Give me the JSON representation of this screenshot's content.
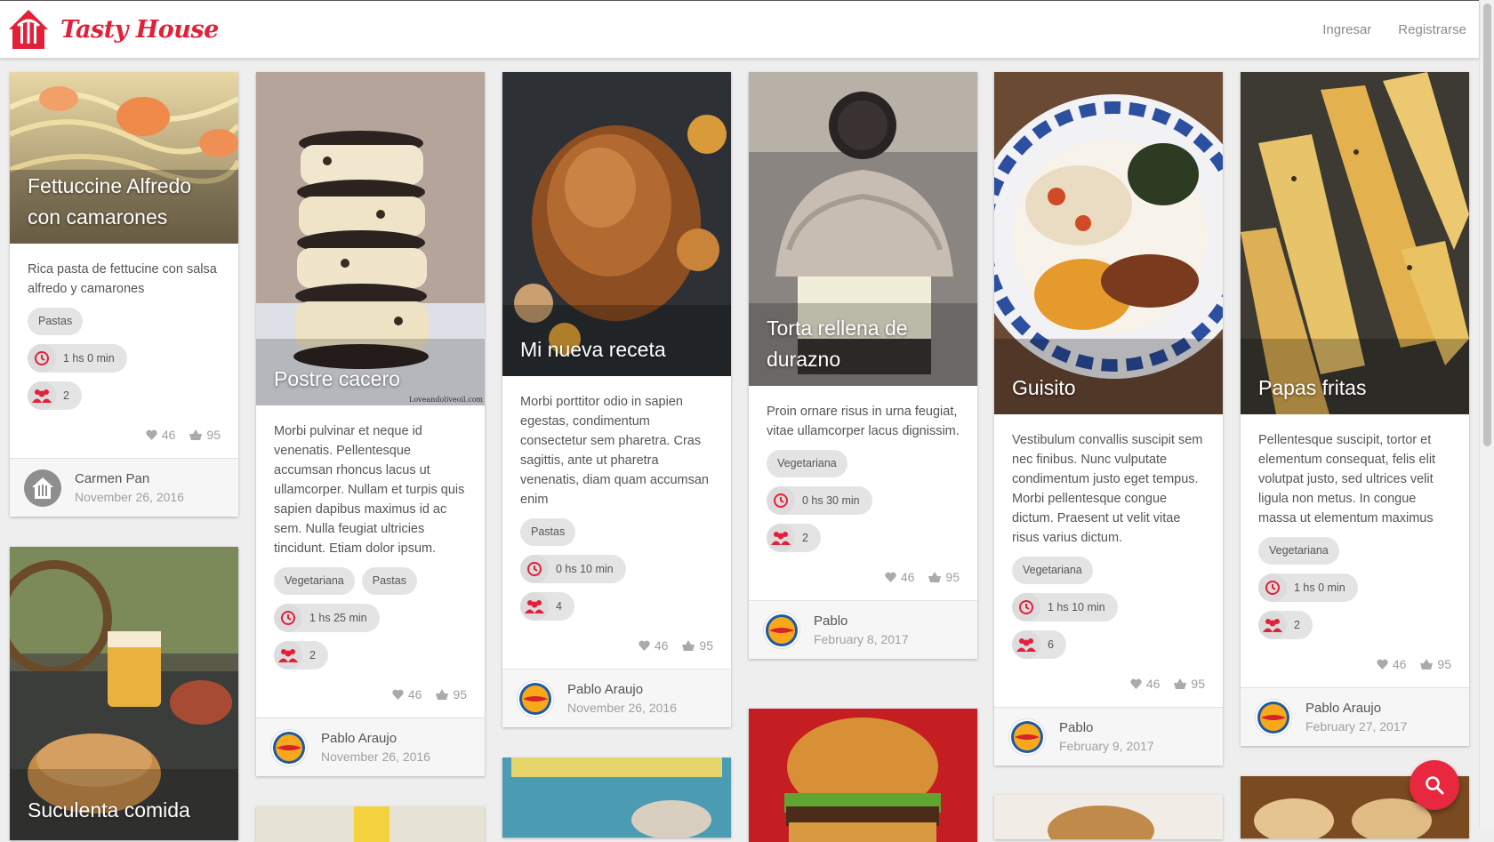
{
  "brand": {
    "name": "Tasty House",
    "accent": "#e2203a"
  },
  "nav": {
    "login": "Ingresar",
    "register": "Registrarse"
  },
  "stats": {
    "likes": "46",
    "saves": "95"
  },
  "cards": [
    {
      "title": "Fettuccine Alfredo con camarones",
      "description": "Rica pasta de fettucine con salsa alfredo y camarones",
      "tags": [
        "Pastas"
      ],
      "time": "1 hs 0 min",
      "servings": "2",
      "author": "Carmen Pan",
      "date": "November 26, 2016"
    },
    {
      "title": "Postre cacero",
      "description": "Morbi pulvinar et neque id venenatis. Pellentesque accumsan rhoncus lacus ut ullamcorper. Nullam et turpis quis sapien dapibus maximus id ac sem. Nulla feugiat ultricies tincidunt. Etiam dolor ipsum.",
      "tags": [
        "Vegetariana",
        "Pastas"
      ],
      "time": "1 hs 25 min",
      "servings": "2",
      "author": "Pablo Araujo",
      "date": "November 26, 2016",
      "watermark": "Loveandoliveoil.com"
    },
    {
      "title": "Mi nueva receta",
      "description": "Morbi porttitor odio in sapien egestas, condimentum consectetur sem pharetra. Cras sagittis, ante ut pharetra venenatis, diam quam accumsan enim",
      "tags": [
        "Pastas"
      ],
      "time": "0 hs 10 min",
      "servings": "4",
      "author": "Pablo Araujo",
      "date": "November 26, 2016"
    },
    {
      "title": "Torta rellena de durazno",
      "description": "Proin ornare risus in urna feugiat, vitae ullamcorper lacus dignissim.",
      "tags": [
        "Vegetariana"
      ],
      "time": "0 hs 30 min",
      "servings": "2",
      "author": "Pablo",
      "date": "February 8, 2017"
    },
    {
      "title": "Guisito",
      "description": "Vestibulum convallis suscipit sem nec finibus. Nunc vulputate condimentum justo eget tempus. Morbi pellentesque congue dictum. Praesent ut velit vitae risus varius dictum.",
      "tags": [
        "Vegetariana"
      ],
      "time": "1 hs 10 min",
      "servings": "6",
      "author": "Pablo",
      "date": "February 9, 2017"
    },
    {
      "title": "Papas fritas",
      "description": "Pellentesque suscipit, tortor et elementum consequat, felis elit volutpat justo, sed ultrices velit ligula non metus. In congue massa ut elementum maximus",
      "tags": [
        "Vegetariana"
      ],
      "time": "1 hs 0 min",
      "servings": "2",
      "author": "Pablo Araujo",
      "date": "February 27, 2017"
    },
    {
      "title": "Suculenta comida"
    }
  ],
  "icons": {
    "search": "search-icon",
    "clock": "clock-icon",
    "people": "people-icon",
    "heart": "heart-icon",
    "basket": "basket-icon"
  }
}
